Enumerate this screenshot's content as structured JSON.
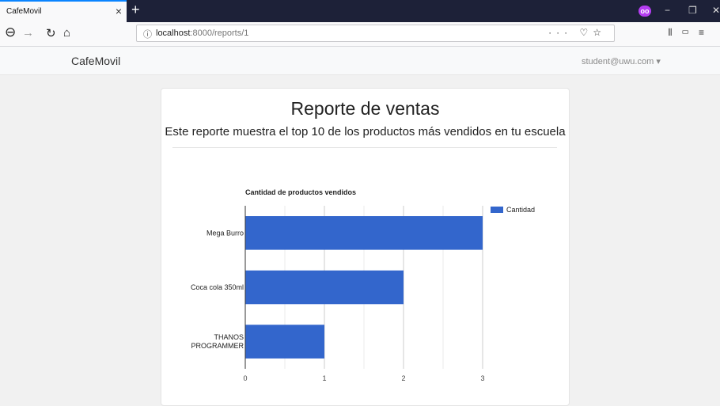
{
  "browser": {
    "tab_title": "CafeMovil",
    "tab_close": "×",
    "new_tab": "+",
    "url_host": "localhost",
    "url_path": ":8000/reports/1",
    "url_info_icon": "info-icon",
    "more_icon": "···",
    "minimize": "−",
    "restore": "❐",
    "close": "✕"
  },
  "header": {
    "brand": "CafeMovil",
    "user": "student@uwu.com ▾"
  },
  "report": {
    "title": "Reporte de ventas",
    "subtitle": "Este reporte muestra el top 10 de los productos más vendidos en tu escuela"
  },
  "chart_data": {
    "type": "bar",
    "orientation": "horizontal",
    "title": "Cantidad de productos vendidos",
    "categories": [
      "Mega Burro",
      "Coca cola 350ml",
      "THANOS PROGRAMMER"
    ],
    "series": [
      {
        "name": "Cantidad",
        "values": [
          3,
          2,
          1
        ]
      }
    ],
    "xlim": [
      0,
      3
    ],
    "xticks": [
      0,
      1,
      2,
      3
    ],
    "grid": true,
    "legend": "right",
    "color": "#3366cc"
  }
}
